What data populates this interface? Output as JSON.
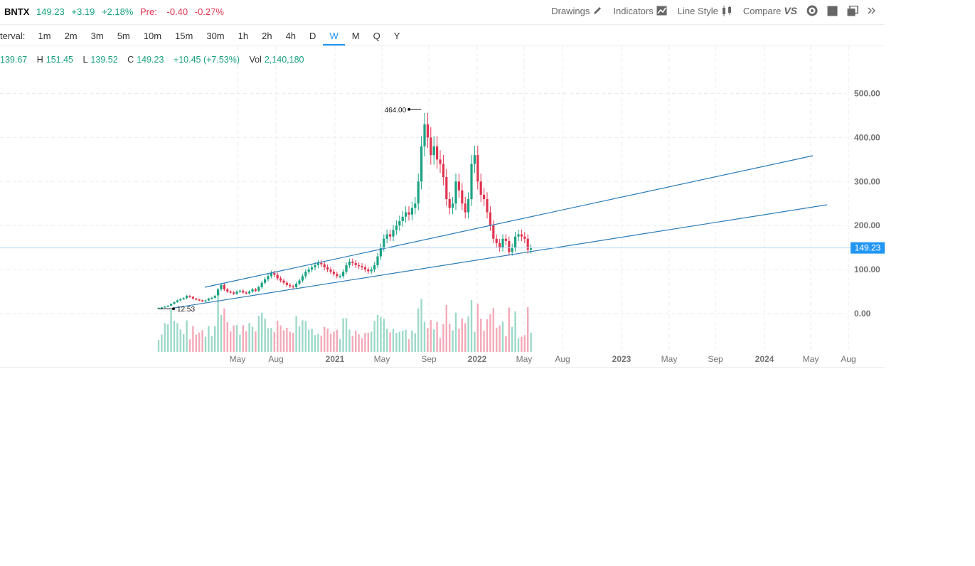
{
  "quote": {
    "symbol": "BNTX",
    "price": "149.23",
    "change": "+3.19",
    "change_pct": "+2.18%",
    "pre_label": "Pre:",
    "pre_change": "-0.40",
    "pre_change_pct": "-0.27%"
  },
  "toolbar": {
    "drawings": "Drawings",
    "indicators": "Indicators",
    "line_style": "Line Style",
    "compare": "Compare"
  },
  "interval": {
    "label": "terval:",
    "options": [
      "1m",
      "2m",
      "3m",
      "5m",
      "10m",
      "15m",
      "30m",
      "1h",
      "2h",
      "4h",
      "D",
      "W",
      "M",
      "Q",
      "Y"
    ],
    "selected": "W"
  },
  "ohlc": {
    "open": "139.67",
    "high_label": "H",
    "high": "151.45",
    "low_label": "L",
    "low": "139.52",
    "close_label": "C",
    "close": "149.23",
    "change": "+10.45 (+7.53%)",
    "vol_label": "Vol",
    "vol": "2,140,180"
  },
  "chart_data": {
    "type": "candlestick",
    "y_ticks": [
      "500.00",
      "400.00",
      "300.00",
      "200.00",
      "100.00",
      "0.00"
    ],
    "ylim": [
      0,
      550
    ],
    "x_ticks": [
      "May",
      "Aug",
      "2021",
      "May",
      "Sep",
      "2022",
      "May",
      "Aug",
      "2023",
      "May",
      "Sep",
      "2024",
      "May",
      "Aug"
    ],
    "last_price_label": "149.23",
    "annotations": [
      {
        "label": "464.00",
        "type": "high"
      },
      {
        "label": "12.53",
        "type": "low"
      }
    ],
    "weekly_close": [
      13,
      14,
      16,
      18,
      22,
      26,
      30,
      33,
      35,
      40,
      38,
      34,
      32,
      30,
      28,
      30,
      34,
      36,
      40,
      55,
      65,
      55,
      50,
      48,
      45,
      50,
      52,
      48,
      46,
      50,
      55,
      52,
      60,
      70,
      78,
      85,
      92,
      88,
      80,
      75,
      70,
      65,
      62,
      60,
      68,
      75,
      85,
      95,
      100,
      105,
      110,
      115,
      112,
      105,
      100,
      95,
      90,
      85,
      85,
      95,
      110,
      118,
      115,
      110,
      108,
      105,
      100,
      96,
      100,
      110,
      130,
      150,
      170,
      180,
      175,
      190,
      200,
      210,
      220,
      230,
      225,
      240,
      250,
      300,
      380,
      430,
      400,
      360,
      380,
      350,
      340,
      310,
      260,
      240,
      250,
      300,
      280,
      250,
      230,
      260,
      340,
      360,
      300,
      270,
      260,
      230,
      200,
      170,
      160,
      150,
      170,
      165,
      140,
      150,
      175,
      180,
      175,
      170,
      145,
      149
    ],
    "trendlines": [
      {
        "name": "upper-channel",
        "from": {
          "date": "2020-03",
          "price": 60
        },
        "to": {
          "date": "2023-05",
          "price": 360
        }
      },
      {
        "name": "lower-channel",
        "from": {
          "date": "2020-02",
          "price": 14
        },
        "to": {
          "date": "2024-06",
          "price": 248
        }
      }
    ]
  },
  "colors": {
    "up": "#1aa283",
    "down": "#e0344f",
    "accent": "#2196f3",
    "trendline": "#2a7bb7"
  }
}
